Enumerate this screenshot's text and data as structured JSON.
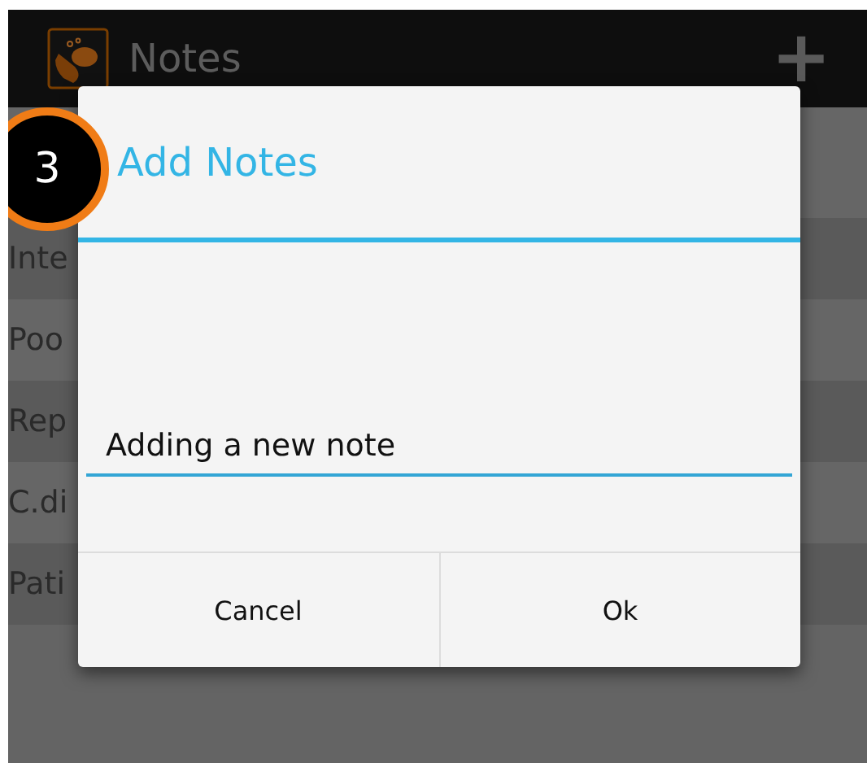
{
  "action_bar": {
    "title": "Notes",
    "add_button": "+"
  },
  "list": {
    "rows": [
      {
        "label": "Inte"
      },
      {
        "label": "Poo"
      },
      {
        "label": "Rep"
      },
      {
        "label": "C.di"
      },
      {
        "label": "Pati"
      }
    ]
  },
  "dialog": {
    "title": "Add Notes",
    "input": {
      "value": "Adding a new note"
    },
    "buttons": [
      {
        "label": "Cancel"
      },
      {
        "label": "Ok"
      }
    ]
  },
  "step_badge": "3"
}
